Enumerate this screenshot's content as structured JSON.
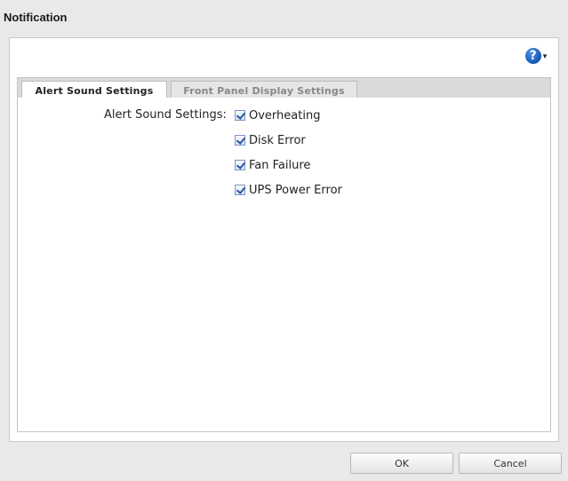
{
  "dialog": {
    "title": "Notification"
  },
  "help": {
    "icon": "help-icon",
    "glyph": "?",
    "caret": "▾"
  },
  "tabs": [
    {
      "label": "Alert Sound Settings",
      "active": true
    },
    {
      "label": "Front Panel Display Settings",
      "active": false
    }
  ],
  "alert_sound": {
    "label": "Alert Sound Settings:",
    "options": [
      {
        "label": "Overheating",
        "checked": true
      },
      {
        "label": "Disk Error",
        "checked": true
      },
      {
        "label": "Fan Failure",
        "checked": true
      },
      {
        "label": "UPS Power Error",
        "checked": true
      }
    ]
  },
  "buttons": {
    "ok": "OK",
    "cancel": "Cancel"
  },
  "colors": {
    "help_blue": "#1759b8",
    "checkbox_check": "#2a56a4"
  }
}
